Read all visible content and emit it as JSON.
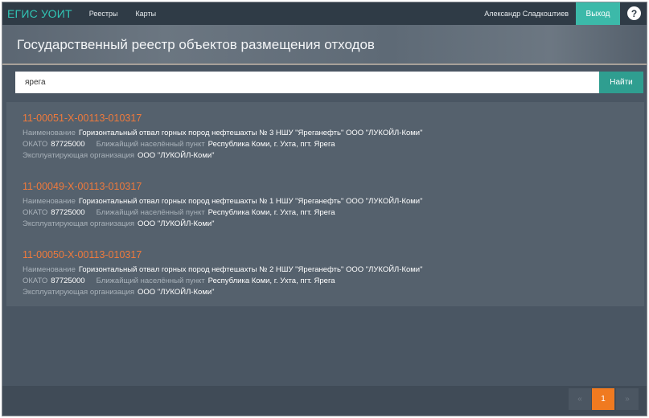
{
  "topbar": {
    "brand": "ЕГИС УОИТ",
    "nav": [
      "Реестры",
      "Карты"
    ],
    "user": "Александр Сладкоштиев",
    "logout_label": "Выход",
    "help_glyph": "?"
  },
  "header": {
    "title": "Государственный реестр объектов размещения отходов"
  },
  "search": {
    "value": "ярега",
    "button_label": "Найти"
  },
  "labels": {
    "name": "Наименование",
    "okato": "ОКАТО",
    "locality": "Ближайщий населённый пункт",
    "org": "Эксплуатирующая организация"
  },
  "results": [
    {
      "id": "11-00051-Х-00113-010317",
      "name": "Горизонтальный отвал горных пород нефтешахты № 3 НШУ \"Яреганефть\" ООО \"ЛУКОЙЛ-Коми\"",
      "okato": "87725000",
      "locality": "Республика Коми, г. Ухта, пгт. Ярега",
      "org": "ООО \"ЛУКОЙЛ-Коми\""
    },
    {
      "id": "11-00049-Х-00113-010317",
      "name": "Горизонтальный отвал горных пород нефтешахты № 1 НШУ \"Яреганефть\" ООО \"ЛУКОЙЛ-Коми\"",
      "okato": "87725000",
      "locality": "Республика Коми, г. Ухта, пгт. Ярега",
      "org": "ООО \"ЛУКОЙЛ-Коми\""
    },
    {
      "id": "11-00050-Х-00113-010317",
      "name": "Горизонтальный отвал горных пород нефтешахты № 2 НШУ \"Яреганефть\" ООО \"ЛУКОЙЛ-Коми\"",
      "okato": "87725000",
      "locality": "Республика Коми, г. Ухта, пгт. Ярега",
      "org": "ООО \"ЛУКОЙЛ-Коми\""
    }
  ],
  "pagination": {
    "prev": "«",
    "current": "1",
    "next": "»"
  }
}
